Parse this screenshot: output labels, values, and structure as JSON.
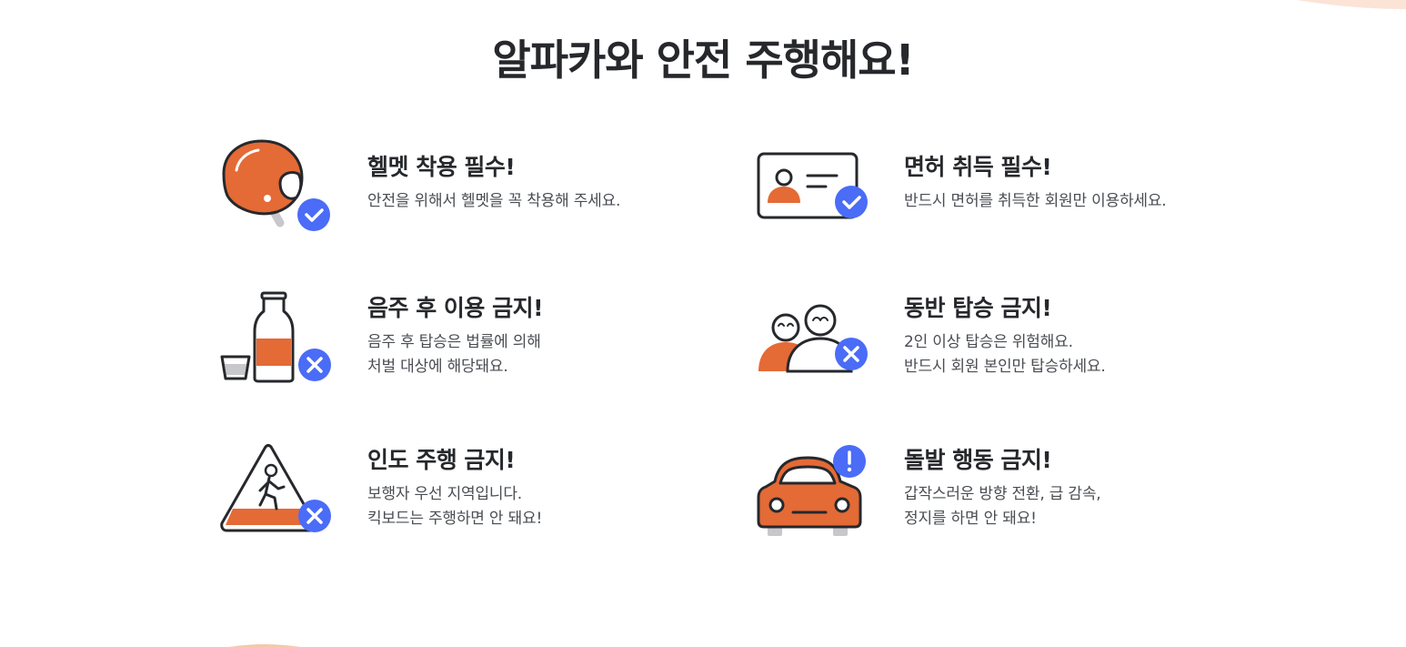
{
  "page": {
    "title": "알파카와 안전 주행해요!"
  },
  "colors": {
    "orange": "#e46a36",
    "dark": "#26282c",
    "blue": "#4a6cf7",
    "grey": "#c8c8cc"
  },
  "rules": [
    {
      "icon": "helmet-check-icon",
      "badge": "check",
      "title": "헬멧 착용 필수!",
      "lines": [
        "안전을 위해서 헬멧을 꼭 착용해 주세요."
      ]
    },
    {
      "icon": "license-check-icon",
      "badge": "check",
      "title": "면허 취득 필수!",
      "lines": [
        "반드시 면허를 취득한 회원만 이용하세요."
      ]
    },
    {
      "icon": "alcohol-forbidden-icon",
      "badge": "x",
      "title": "음주 후 이용 금지!",
      "lines": [
        "음주 후 탑승은 법률에 의해",
        "처벌 대상에 해당돼요."
      ]
    },
    {
      "icon": "two-riders-forbidden-icon",
      "badge": "x",
      "title": "동반 탑승 금지!",
      "lines": [
        "2인 이상 탑승은 위험해요.",
        "반드시 회원 본인만 탑승하세요."
      ]
    },
    {
      "icon": "sidewalk-forbidden-icon",
      "badge": "x",
      "title": "인도 주행 금지!",
      "lines": [
        "보행자 우선 지역입니다.",
        "킥보드는 주행하면 안 돼요!"
      ]
    },
    {
      "icon": "car-warning-icon",
      "badge": "!",
      "title": "돌발 행동 금지!",
      "lines": [
        "갑작스러운 방향 전환, 급 감속,",
        "정지를 하면 안 돼요!"
      ]
    }
  ]
}
